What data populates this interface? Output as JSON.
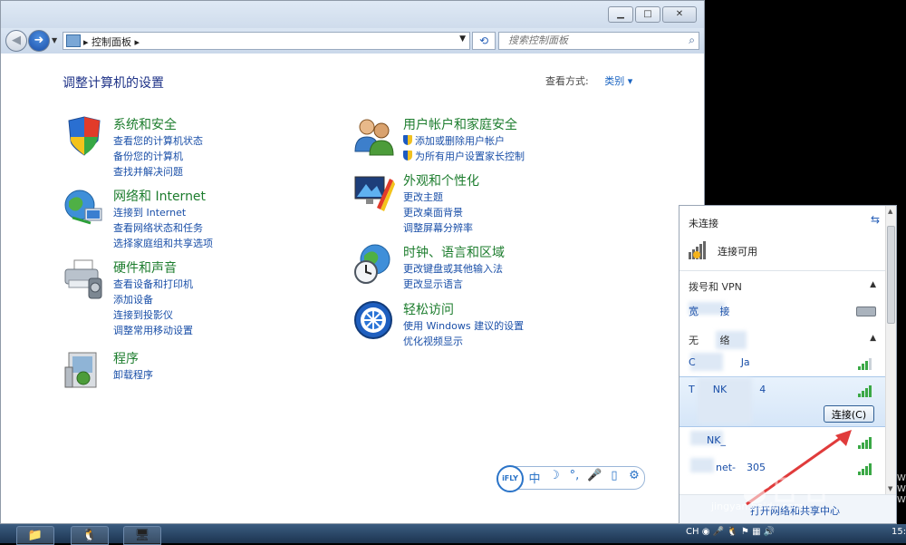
{
  "navbar": {
    "address_segment": "控制面板",
    "search_placeholder": "搜索控制面板"
  },
  "page": {
    "heading": "调整计算机的设置",
    "view_by_label": "查看方式:",
    "view_by_value": "类别"
  },
  "categories_left": [
    {
      "title": "系统和安全",
      "icon": "shield-icon",
      "links": [
        "查看您的计算机状态",
        "备份您的计算机",
        "查找并解决问题"
      ]
    },
    {
      "title": "网络和 Internet",
      "icon": "globe-network-icon",
      "links": [
        "连接到 Internet",
        "查看网络状态和任务",
        "选择家庭组和共享选项"
      ]
    },
    {
      "title": "硬件和声音",
      "icon": "printer-icon",
      "links": [
        "查看设备和打印机",
        "添加设备",
        "连接到投影仪",
        "调整常用移动设置"
      ]
    },
    {
      "title": "程序",
      "icon": "programs-icon",
      "links": [
        "卸载程序"
      ]
    }
  ],
  "categories_right": [
    {
      "title": "用户帐户和家庭安全",
      "icon": "users-icon",
      "links": [
        "添加或删除用户帐户",
        "为所有用户设置家长控制"
      ]
    },
    {
      "title": "外观和个性化",
      "icon": "monitor-icon",
      "links": [
        "更改主题",
        "更改桌面背景",
        "调整屏幕分辨率"
      ]
    },
    {
      "title": "时钟、语言和区域",
      "icon": "clock-globe-icon",
      "links": [
        "更改键盘或其他输入法",
        "更改显示语言"
      ]
    },
    {
      "title": "轻松访问",
      "icon": "ease-of-access-icon",
      "links": [
        "使用 Windows 建议的设置",
        "优化视频显示"
      ]
    }
  ],
  "flyout": {
    "status": "未连接",
    "available": "连接可用",
    "dialup_section": "拨号和 VPN",
    "dialup_item": "宽",
    "dialup_item_2": "接",
    "wireless_section": "无",
    "wireless_section_2": "络",
    "networks": [
      "C",
      "Ja",
      "T",
      "NK",
      "4",
      "NK_",
      "net-",
      "305"
    ],
    "connect_button": "连接(C)",
    "footer_link": "打开网络和共享中心"
  },
  "watermark": "jingyan.baidu.com",
  "right_edge": [
    "Win",
    "Win",
    "Win"
  ],
  "tray": "CH",
  "clock": "15:",
  "ifly": {
    "logo": "iFLY",
    "mode": "中"
  }
}
